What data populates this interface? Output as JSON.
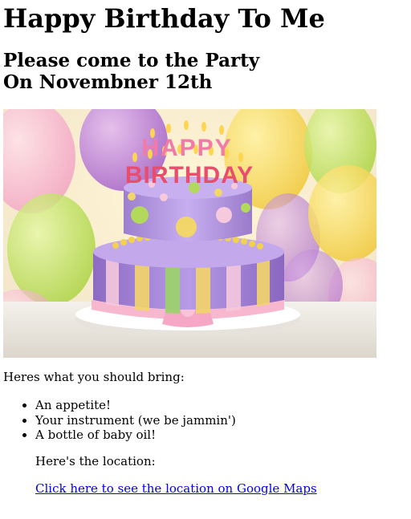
{
  "title": "Happy Birthday To Me",
  "subtitle_line1": "Please come to the Party",
  "subtitle_line2": "On Novembner 12th",
  "image": {
    "cake_top_text": "HAPPY",
    "cake_bottom_text": "BIRTHDAY"
  },
  "bring_intro": "Heres what you should bring:",
  "bring_items": [
    "An appetite!",
    "Your instrument (we be jammin')",
    "A bottle of baby oil!"
  ],
  "location_text": "Here's the location:",
  "maps_link_text": "Click here to see the location on Google Maps",
  "colors": {
    "link": "#0000ee",
    "text": "#000000",
    "background": "#ffffff"
  }
}
